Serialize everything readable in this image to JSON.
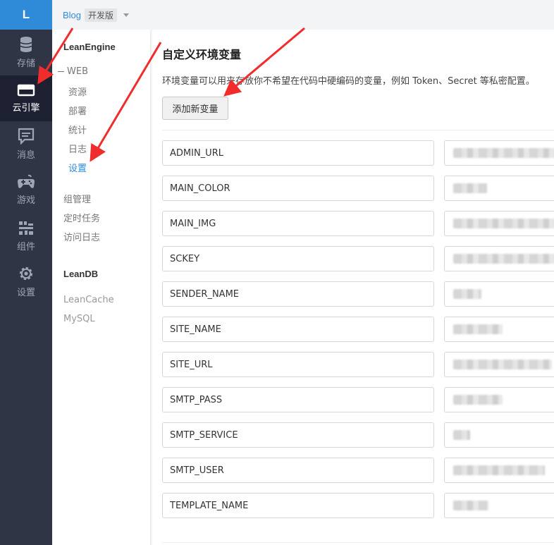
{
  "logo": "L",
  "nav": [
    {
      "label": "存储",
      "icon": "database-icon"
    },
    {
      "label": "云引擎",
      "icon": "cloud-engine-icon",
      "active": true
    },
    {
      "label": "消息",
      "icon": "message-icon"
    },
    {
      "label": "游戏",
      "icon": "gamepad-icon"
    },
    {
      "label": "组件",
      "icon": "components-icon"
    },
    {
      "label": "设置",
      "icon": "gear-icon"
    }
  ],
  "topbar": {
    "app": "Blog",
    "badge": "开发版"
  },
  "subnav": {
    "section1": "LeanEngine",
    "group": "WEB",
    "items": [
      "资源",
      "部署",
      "统计",
      "日志",
      "设置"
    ],
    "active_item": "设置",
    "extra": [
      "组管理",
      "定时任务",
      "访问日志"
    ],
    "section2": "LeanDB",
    "db_items": [
      "LeanCache",
      "MySQL"
    ]
  },
  "main": {
    "title": "自定义环境变量",
    "description": "环境变量可以用来存放你不希望在代码中硬编码的变量，例如 Token、Secret 等私密配置。",
    "add_button": "添加新变量",
    "variables": [
      "ADMIN_URL",
      "MAIN_COLOR",
      "MAIN_IMG",
      "SCKEY",
      "SENDER_NAME",
      "SITE_NAME",
      "SITE_URL",
      "SMTP_PASS",
      "SMTP_SERVICE",
      "SMTP_USER",
      "TEMPLATE_NAME"
    ]
  },
  "colors": {
    "accent": "#2f8bd8",
    "sidebar": "#303546",
    "arrow": "#f02c2c"
  }
}
